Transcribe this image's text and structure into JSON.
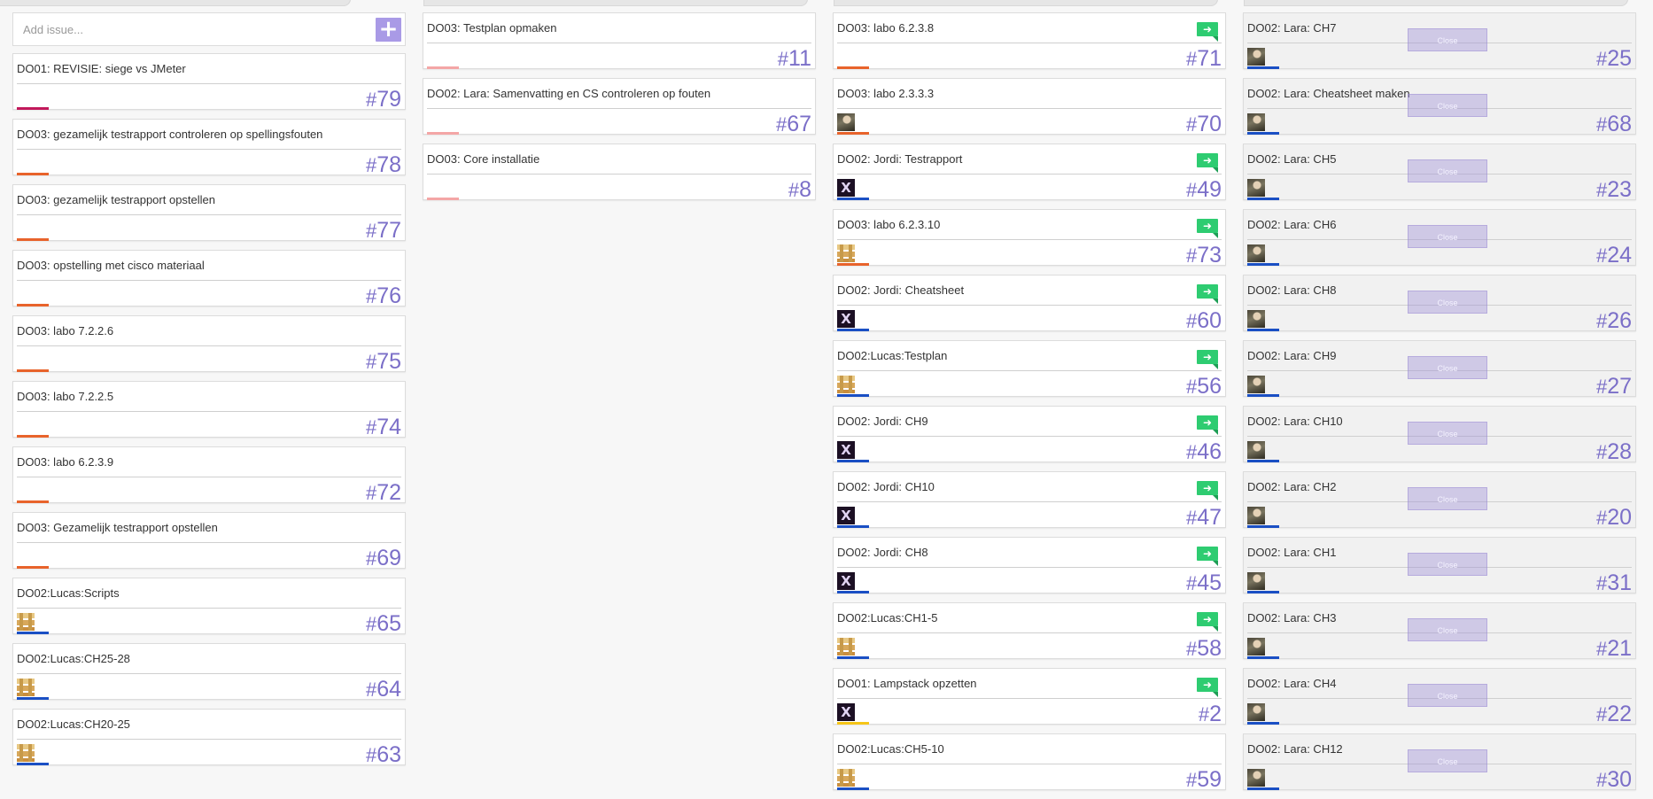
{
  "colors": {
    "accent": "#7b6fc8",
    "add_button": "#a99ae6",
    "move_flag": "#2ecc71",
    "bar_magenta": "#c2185b",
    "bar_orange": "#e8632b",
    "bar_pink": "#f4a6a6",
    "bar_blue": "#1a4fc4",
    "bar_yellow": "#f5c518"
  },
  "add_issue": {
    "placeholder": "Add issue...",
    "button_label": "+"
  },
  "columns": [
    {
      "cards": [
        {
          "title": "DO01: REVISIE: siege vs JMeter",
          "number": "79",
          "bar": "bar_magenta"
        },
        {
          "title": "DO03: gezamelijk testrapport controleren op spellingsfouten",
          "number": "78",
          "bar": "bar_orange"
        },
        {
          "title": "DO03: gezamelijk testrapport opstellen",
          "number": "77",
          "bar": "bar_orange"
        },
        {
          "title": "DO03: opstelling met cisco materiaal",
          "number": "76",
          "bar": "bar_orange"
        },
        {
          "title": "DO03: labo 7.2.2.6",
          "number": "75",
          "bar": "bar_orange"
        },
        {
          "title": "DO03: labo 7.2.2.5",
          "number": "74",
          "bar": "bar_orange"
        },
        {
          "title": "DO03: labo 6.2.3.9",
          "number": "72",
          "bar": "bar_orange"
        },
        {
          "title": "DO03: Gezamelijk testrapport opstellen",
          "number": "69",
          "bar": "bar_orange"
        },
        {
          "title": "DO02:Lucas:Scripts",
          "number": "65",
          "bar": "bar_blue",
          "avatar": "pixel"
        },
        {
          "title": "DO02:Lucas:CH25-28",
          "number": "64",
          "bar": "bar_blue",
          "avatar": "pixel"
        },
        {
          "title": "DO02:Lucas:CH20-25",
          "number": "63",
          "bar": "bar_blue",
          "avatar": "pixel"
        }
      ]
    },
    {
      "cards": [
        {
          "title": "DO03: Testplan opmaken",
          "number": "11",
          "bar": "bar_pink"
        },
        {
          "title": "DO02: Lara: Samenvatting en CS controleren op fouten",
          "number": "67",
          "bar": "bar_pink"
        },
        {
          "title": "DO03: Core installatie",
          "number": "8",
          "bar": "bar_pink"
        }
      ]
    },
    {
      "move_label": "➜",
      "cards": [
        {
          "title": "DO03: labo 6.2.3.8",
          "number": "71",
          "bar": "bar_orange",
          "flag": true
        },
        {
          "title": "DO03: labo 2.3.3.3",
          "number": "70",
          "bar": "bar_orange",
          "avatar": "photo"
        },
        {
          "title": "DO02: Jordi: Testrapport",
          "number": "49",
          "bar": "bar_blue",
          "avatar": "x",
          "flag": true
        },
        {
          "title": "DO03: labo 6.2.3.10",
          "number": "73",
          "bar": "bar_orange",
          "avatar": "pixel",
          "flag": true
        },
        {
          "title": "DO02: Jordi: Cheatsheet",
          "number": "60",
          "bar": "bar_blue",
          "avatar": "x",
          "flag": true
        },
        {
          "title": "DO02:Lucas:Testplan",
          "number": "56",
          "bar": "bar_blue",
          "avatar": "pixel",
          "flag": true
        },
        {
          "title": "DO02: Jordi: CH9",
          "number": "46",
          "bar": "bar_blue",
          "avatar": "x",
          "flag": true
        },
        {
          "title": "DO02: Jordi: CH10",
          "number": "47",
          "bar": "bar_blue",
          "avatar": "x",
          "flag": true
        },
        {
          "title": "DO02: Jordi: CH8",
          "number": "45",
          "bar": "bar_blue",
          "avatar": "x",
          "flag": true
        },
        {
          "title": "DO02:Lucas:CH1-5",
          "number": "58",
          "bar": "bar_blue",
          "avatar": "pixel",
          "flag": true
        },
        {
          "title": "DO01: Lampstack opzetten",
          "number": "2",
          "bar": "bar_yellow",
          "avatar": "x",
          "flag": true
        },
        {
          "title": "DO02:Lucas:CH5-10",
          "number": "59",
          "bar": "bar_blue",
          "avatar": "pixel"
        }
      ]
    },
    {
      "close_label": "Close",
      "cards": [
        {
          "title": "DO02: Lara: CH7",
          "number": "25",
          "bar": "bar_blue",
          "avatar": "photo"
        },
        {
          "title": "DO02: Lara: Cheatsheet maken",
          "number": "68",
          "bar": "bar_blue",
          "avatar": "photo"
        },
        {
          "title": "DO02: Lara: CH5",
          "number": "23",
          "bar": "bar_blue",
          "avatar": "photo"
        },
        {
          "title": "DO02: Lara: CH6",
          "number": "24",
          "bar": "bar_blue",
          "avatar": "photo"
        },
        {
          "title": "DO02: Lara: CH8",
          "number": "26",
          "bar": "bar_blue",
          "avatar": "photo"
        },
        {
          "title": "DO02: Lara: CH9",
          "number": "27",
          "bar": "bar_blue",
          "avatar": "photo"
        },
        {
          "title": "DO02: Lara: CH10",
          "number": "28",
          "bar": "bar_blue",
          "avatar": "photo"
        },
        {
          "title": "DO02: Lara: CH2",
          "number": "20",
          "bar": "bar_blue",
          "avatar": "photo"
        },
        {
          "title": "DO02: Lara: CH1",
          "number": "31",
          "bar": "bar_blue",
          "avatar": "photo"
        },
        {
          "title": "DO02: Lara: CH3",
          "number": "21",
          "bar": "bar_blue",
          "avatar": "photo"
        },
        {
          "title": "DO02: Lara: CH4",
          "number": "22",
          "bar": "bar_blue",
          "avatar": "photo"
        },
        {
          "title": "DO02: Lara: CH12",
          "number": "30",
          "bar": "bar_blue",
          "avatar": "photo"
        }
      ]
    }
  ]
}
